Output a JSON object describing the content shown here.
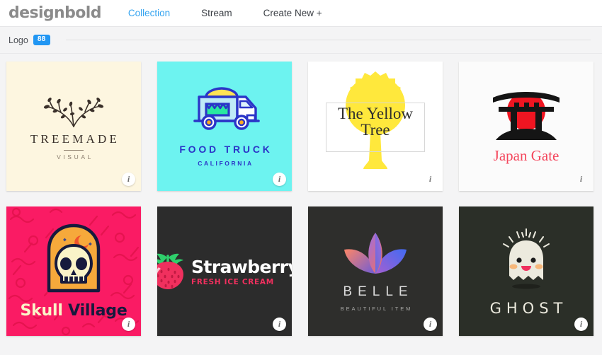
{
  "header": {
    "brand": "designbold",
    "nav": [
      {
        "label": "Collection",
        "active": true
      },
      {
        "label": "Stream",
        "active": false
      },
      {
        "label": "Create New +",
        "active": false
      }
    ]
  },
  "section": {
    "label": "Logo",
    "count": "88",
    "badge_color": "#2196f3"
  },
  "cards": [
    {
      "name": "treemade",
      "title": "TREEMADE",
      "subtitle": "VISUAL",
      "bg": "#fdf6e0",
      "info_label": "i",
      "icon": "tree-branch-icon"
    },
    {
      "name": "food-truck",
      "title": "FOOD TRUCK",
      "subtitle": "CALIFORNIA",
      "bg": "#6df3f0",
      "info_label": "i",
      "icon": "food-truck-icon"
    },
    {
      "name": "yellow-tree",
      "title_line1": "The Yellow",
      "title_line2": "Tree",
      "bg": "#ffffff",
      "info_label": "i",
      "icon": "yellow-tree-icon"
    },
    {
      "name": "japan-gate",
      "title": "Japan Gate",
      "bg": "#fbfbfb",
      "title_color": "#f4465c",
      "info_label": "i",
      "icon": "torii-gate-icon"
    },
    {
      "name": "skull-village",
      "title_part1": "Skull",
      "title_part2": "Village",
      "bg": "#fa1b64",
      "info_label": "i",
      "icon": "skull-arch-icon"
    },
    {
      "name": "strawberry",
      "title": "Strawberry",
      "subtitle": "FRESH ICE CREAM",
      "bg": "#2c2c2c",
      "subtitle_color": "#f0305e",
      "info_label": "i",
      "icon": "strawberry-icon"
    },
    {
      "name": "belle",
      "title": "BELLE",
      "subtitle": "BEAUTIFUL ITEM",
      "bg": "#2e2e2c",
      "info_label": "i",
      "icon": "lotus-flower-icon"
    },
    {
      "name": "ghost",
      "title": "GHOST",
      "bg": "#2b2f28",
      "info_label": "i",
      "icon": "ghost-icon"
    }
  ]
}
